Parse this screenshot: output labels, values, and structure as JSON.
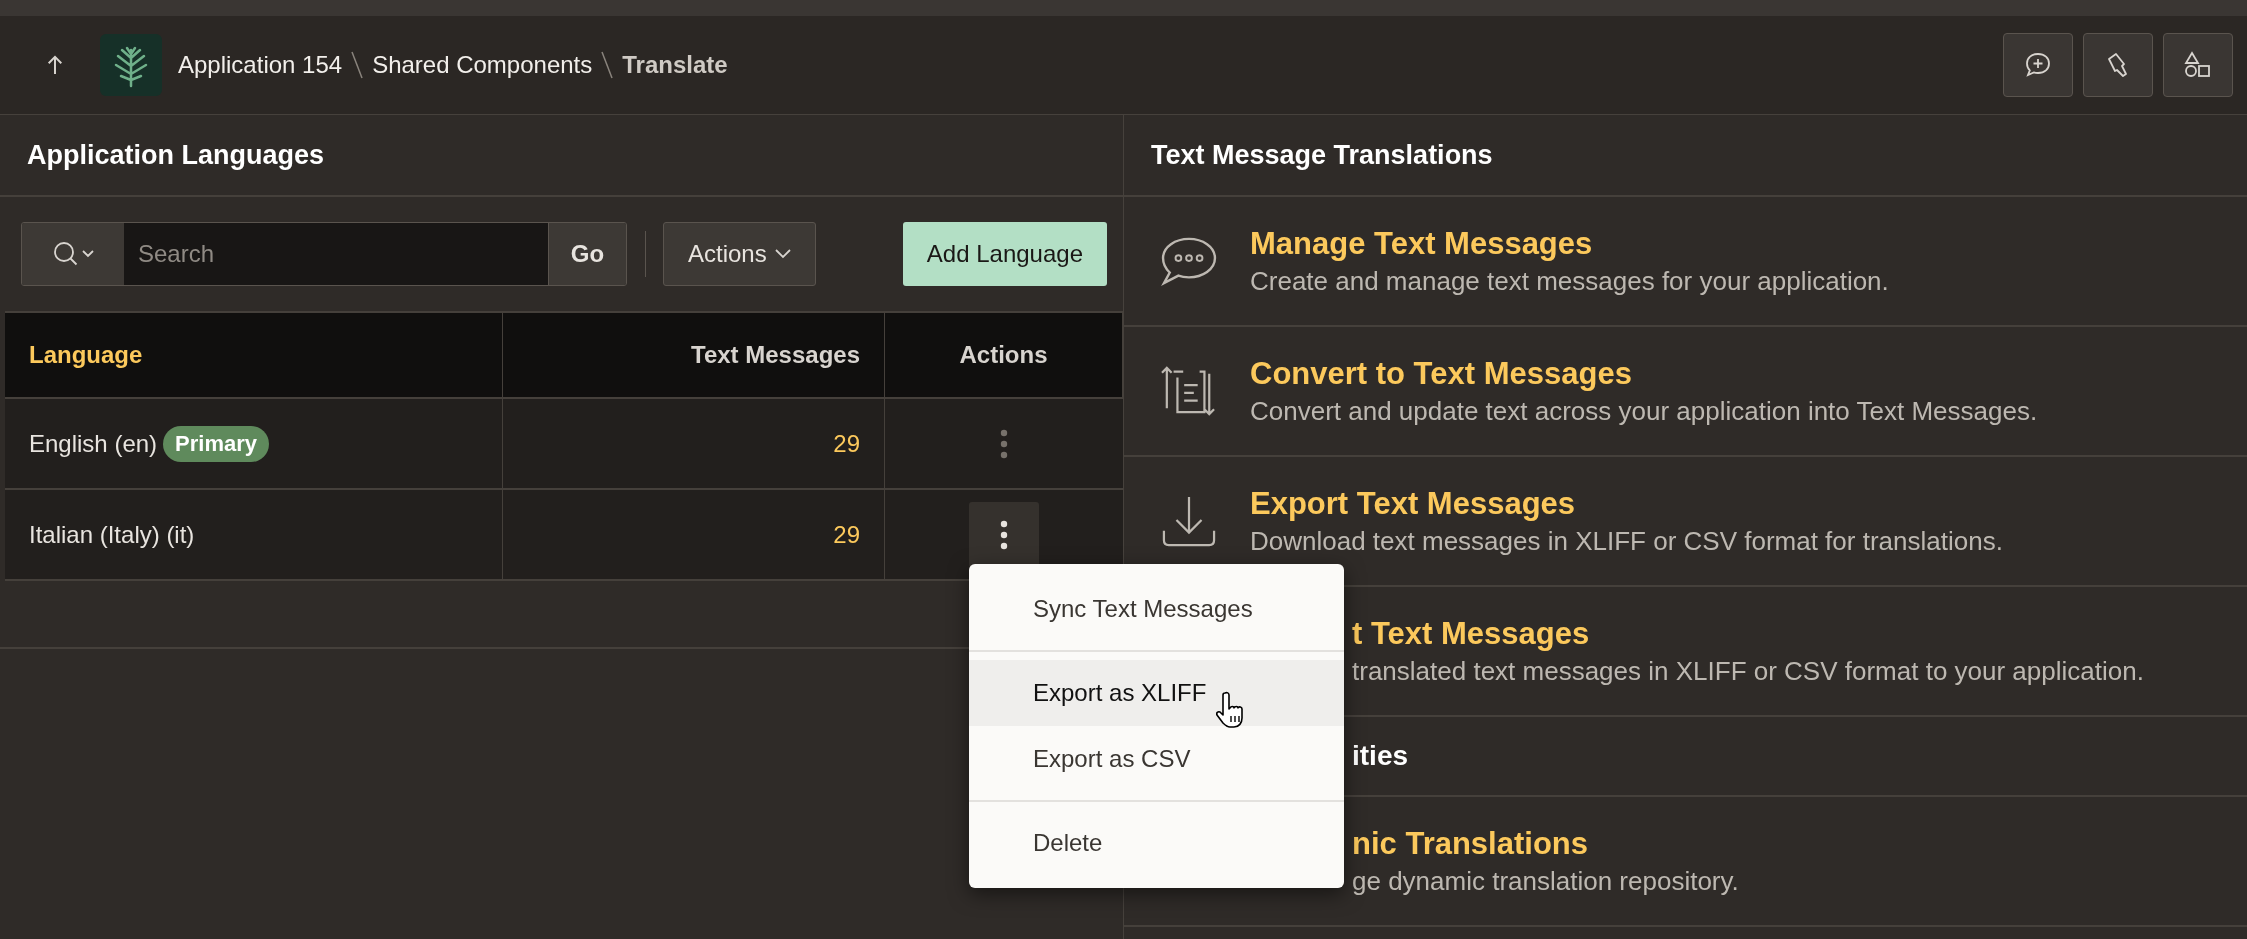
{
  "header": {
    "breadcrumb": [
      {
        "label": "Application 154",
        "current": false
      },
      {
        "label": "Shared Components",
        "current": false
      },
      {
        "label": "Translate",
        "current": true
      }
    ]
  },
  "languages": {
    "title": "Application Languages",
    "search": {
      "placeholder": "Search"
    },
    "go": "Go",
    "actions": "Actions",
    "add": "Add Language",
    "columns": [
      {
        "label": "Language",
        "sorted": true
      },
      {
        "label": "Text Messages",
        "sorted": false
      },
      {
        "label": "Actions",
        "sorted": false
      }
    ],
    "rows": [
      {
        "language": "English (en)",
        "badge": "Primary",
        "messages": "29",
        "menu_open": false
      },
      {
        "language": "Italian (Italy) (it)",
        "messages": "29",
        "menu_open": true
      }
    ]
  },
  "menu": {
    "groups": [
      [
        {
          "label": "Sync Text Messages",
          "selected": false
        }
      ],
      [
        {
          "label": "Export as XLIFF",
          "selected": true
        },
        {
          "label": "Export as CSV",
          "selected": false
        }
      ],
      [
        {
          "label": "Delete",
          "selected": false
        }
      ]
    ]
  },
  "translations": {
    "title": "Text Message Translations",
    "items": [
      {
        "kind": "link",
        "title": "Manage Text Messages",
        "description": "Create and manage text messages for your application.",
        "covered": false
      },
      {
        "kind": "link",
        "title": "Convert to Text Messages",
        "description": "Convert and update text across your application into Text Messages.",
        "covered": false
      },
      {
        "kind": "link",
        "title": "Export Text Messages",
        "description": "Download text messages in XLIFF or CSV format for translations.",
        "covered": false
      },
      {
        "kind": "link",
        "title": "t Text Messages",
        "description": "translated text messages in XLIFF or CSV format to your application.",
        "covered": true
      },
      {
        "kind": "heading",
        "title": "ities",
        "covered": true
      },
      {
        "kind": "link",
        "title": "nic Translations",
        "description": "ge dynamic translation repository.",
        "covered": true
      }
    ]
  }
}
